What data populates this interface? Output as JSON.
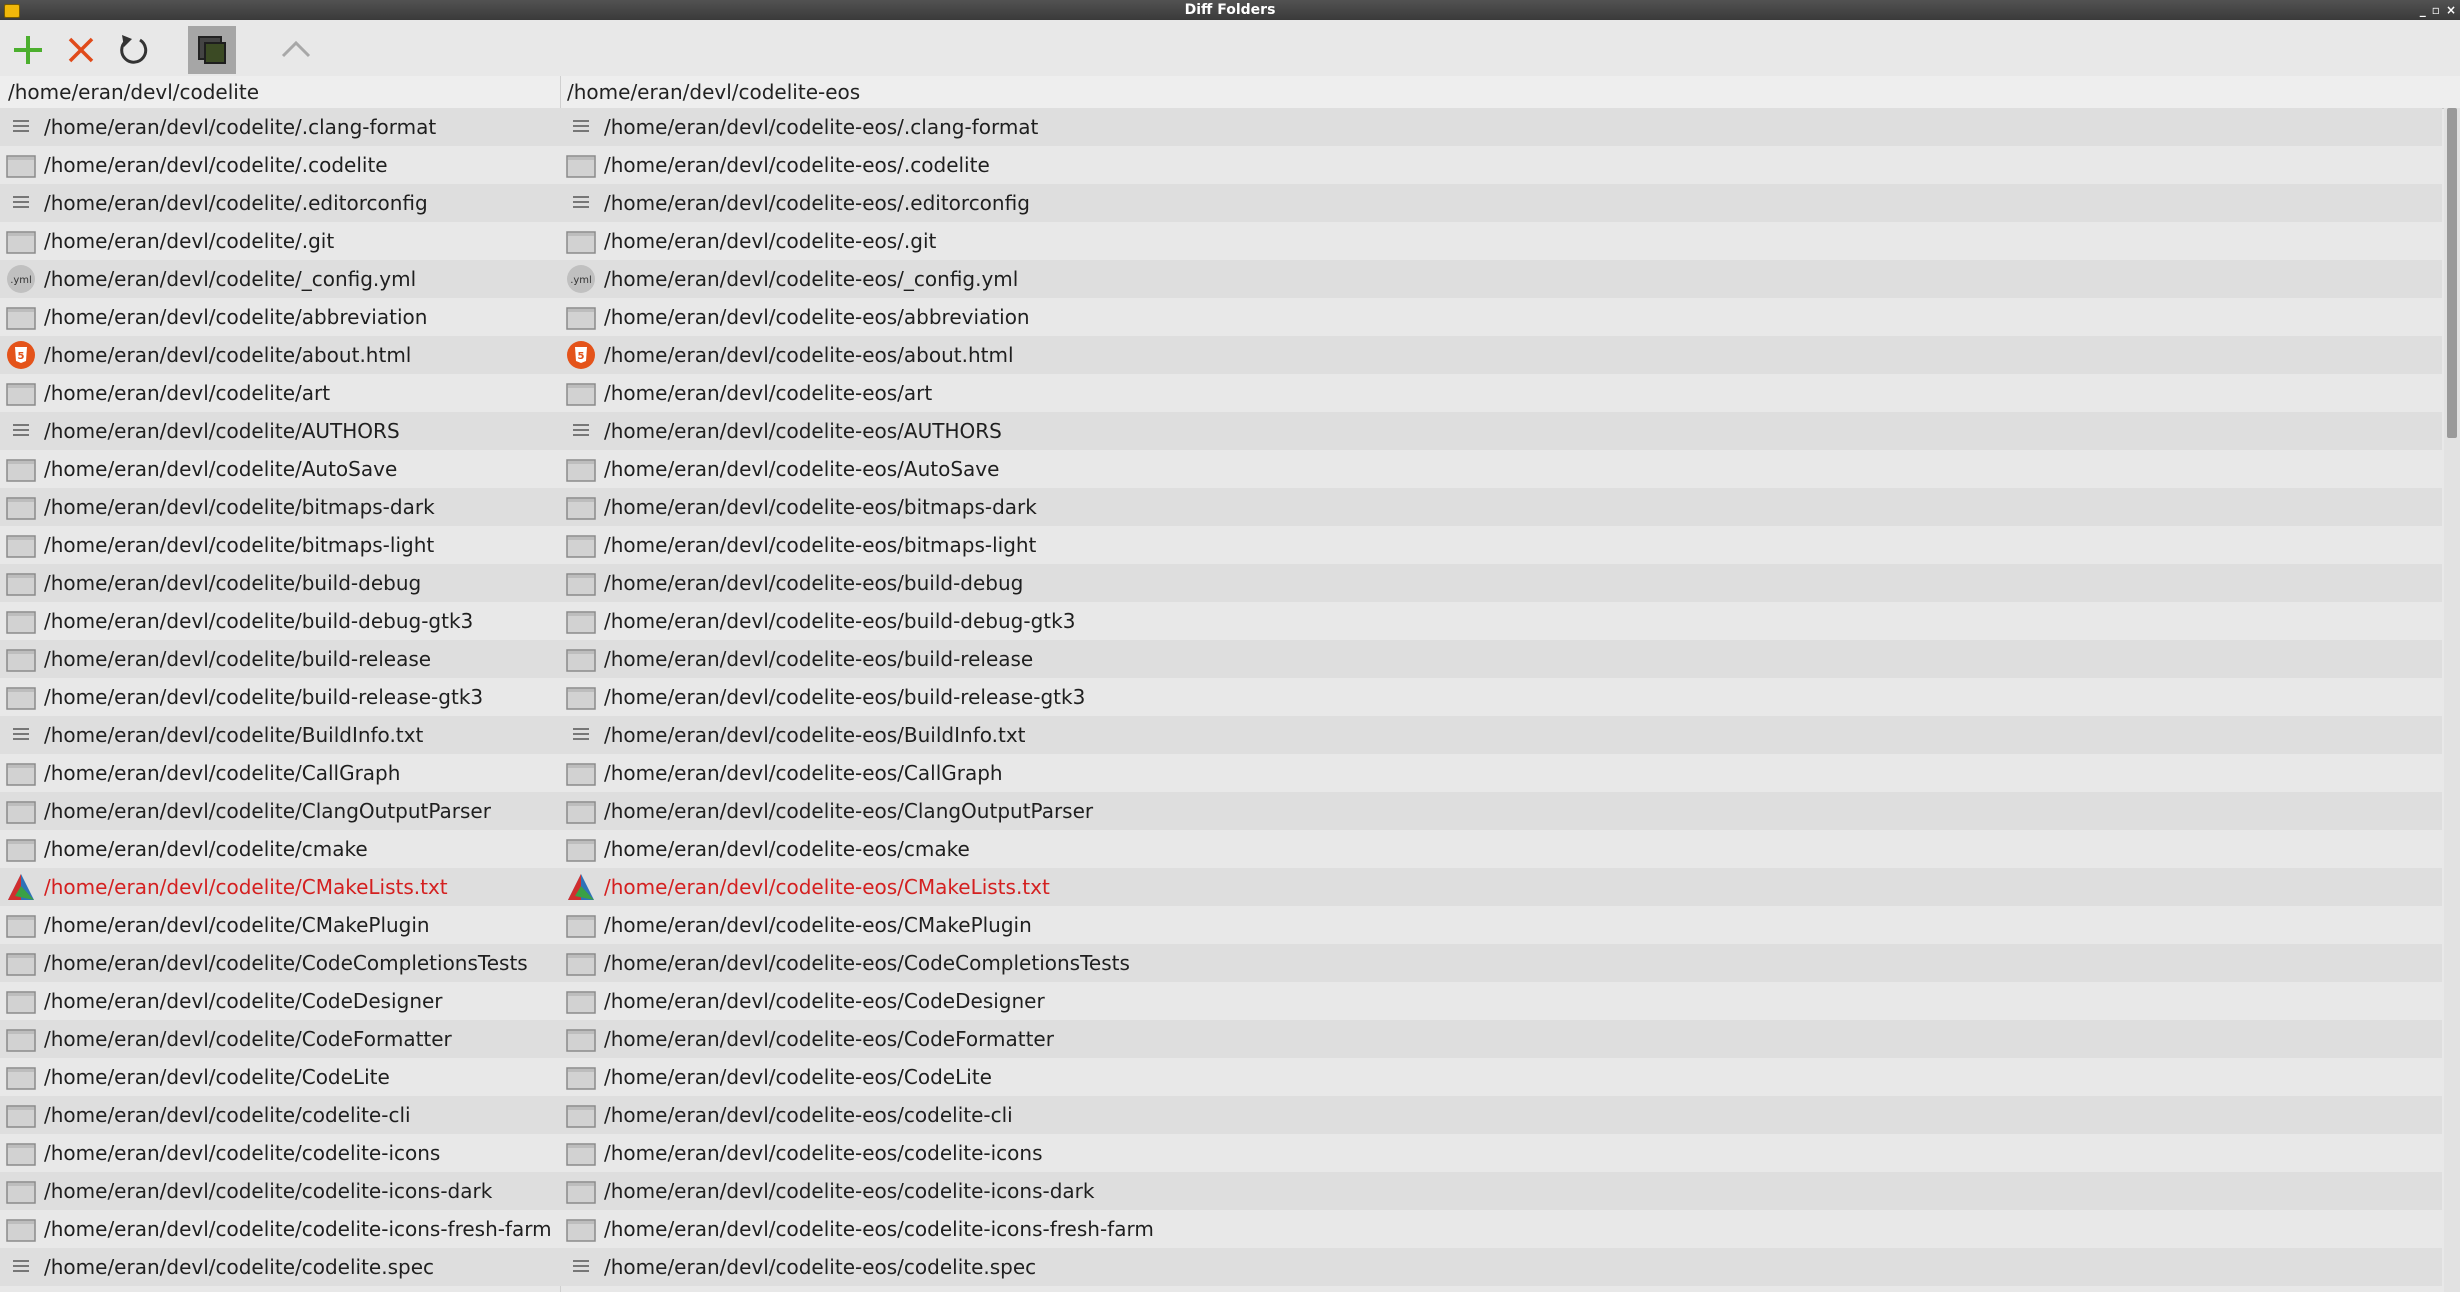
{
  "window": {
    "title": "Diff Folders",
    "controls": [
      "_",
      "▫",
      "×"
    ]
  },
  "toolbar": {
    "buttons": [
      {
        "name": "new-comparison-button",
        "icon": "plus-icon",
        "color": "#4caf2e"
      },
      {
        "name": "clear-button",
        "icon": "close-icon",
        "color": "#e04a1a"
      },
      {
        "name": "refresh-button",
        "icon": "refresh-icon",
        "color": "#333333"
      },
      {
        "name": "show-similar-button",
        "icon": "show-similar-icon",
        "active": true
      },
      {
        "name": "up-folder-button",
        "icon": "chevron-up-icon",
        "disabled": true
      }
    ]
  },
  "headers": {
    "left": "/home/eran/devl/codelite",
    "right": "/home/eran/devl/codelite-eos"
  },
  "colors": {
    "modified": "#d42020",
    "html": "#e4531a"
  },
  "rows": [
    {
      "name": ".clang-format",
      "icon": "text-file-icon",
      "modified": false,
      "left": "/home/eran/devl/codelite/.clang-format",
      "right": "/home/eran/devl/codelite-eos/.clang-format"
    },
    {
      "name": ".codelite",
      "icon": "folder-icon",
      "modified": false,
      "left": "/home/eran/devl/codelite/.codelite",
      "right": "/home/eran/devl/codelite-eos/.codelite"
    },
    {
      "name": ".editorconfig",
      "icon": "text-file-icon",
      "modified": false,
      "left": "/home/eran/devl/codelite/.editorconfig",
      "right": "/home/eran/devl/codelite-eos/.editorconfig"
    },
    {
      "name": ".git",
      "icon": "folder-icon",
      "modified": false,
      "left": "/home/eran/devl/codelite/.git",
      "right": "/home/eran/devl/codelite-eos/.git"
    },
    {
      "name": "_config.yml",
      "icon": "yml-icon",
      "icon_text": ".yml",
      "modified": false,
      "left": "/home/eran/devl/codelite/_config.yml",
      "right": "/home/eran/devl/codelite-eos/_config.yml"
    },
    {
      "name": "abbreviation",
      "icon": "folder-icon",
      "modified": false,
      "left": "/home/eran/devl/codelite/abbreviation",
      "right": "/home/eran/devl/codelite-eos/abbreviation"
    },
    {
      "name": "about.html",
      "icon": "html-icon",
      "icon_text": "5",
      "modified": false,
      "left": "/home/eran/devl/codelite/about.html",
      "right": "/home/eran/devl/codelite-eos/about.html"
    },
    {
      "name": "art",
      "icon": "folder-icon",
      "modified": false,
      "left": "/home/eran/devl/codelite/art",
      "right": "/home/eran/devl/codelite-eos/art"
    },
    {
      "name": "AUTHORS",
      "icon": "text-file-icon",
      "modified": false,
      "left": "/home/eran/devl/codelite/AUTHORS",
      "right": "/home/eran/devl/codelite-eos/AUTHORS"
    },
    {
      "name": "AutoSave",
      "icon": "folder-icon",
      "modified": false,
      "left": "/home/eran/devl/codelite/AutoSave",
      "right": "/home/eran/devl/codelite-eos/AutoSave"
    },
    {
      "name": "bitmaps-dark",
      "icon": "folder-icon",
      "modified": false,
      "left": "/home/eran/devl/codelite/bitmaps-dark",
      "right": "/home/eran/devl/codelite-eos/bitmaps-dark"
    },
    {
      "name": "bitmaps-light",
      "icon": "folder-icon",
      "modified": false,
      "left": "/home/eran/devl/codelite/bitmaps-light",
      "right": "/home/eran/devl/codelite-eos/bitmaps-light"
    },
    {
      "name": "build-debug",
      "icon": "folder-icon",
      "modified": false,
      "left": "/home/eran/devl/codelite/build-debug",
      "right": "/home/eran/devl/codelite-eos/build-debug"
    },
    {
      "name": "build-debug-gtk3",
      "icon": "folder-icon",
      "modified": false,
      "left": "/home/eran/devl/codelite/build-debug-gtk3",
      "right": "/home/eran/devl/codelite-eos/build-debug-gtk3"
    },
    {
      "name": "build-release",
      "icon": "folder-icon",
      "modified": false,
      "left": "/home/eran/devl/codelite/build-release",
      "right": "/home/eran/devl/codelite-eos/build-release"
    },
    {
      "name": "build-release-gtk3",
      "icon": "folder-icon",
      "modified": false,
      "left": "/home/eran/devl/codelite/build-release-gtk3",
      "right": "/home/eran/devl/codelite-eos/build-release-gtk3"
    },
    {
      "name": "BuildInfo.txt",
      "icon": "text-file-icon",
      "modified": false,
      "left": "/home/eran/devl/codelite/BuildInfo.txt",
      "right": "/home/eran/devl/codelite-eos/BuildInfo.txt"
    },
    {
      "name": "CallGraph",
      "icon": "folder-icon",
      "modified": false,
      "left": "/home/eran/devl/codelite/CallGraph",
      "right": "/home/eran/devl/codelite-eos/CallGraph"
    },
    {
      "name": "ClangOutputParser",
      "icon": "folder-icon",
      "modified": false,
      "left": "/home/eran/devl/codelite/ClangOutputParser",
      "right": "/home/eran/devl/codelite-eos/ClangOutputParser"
    },
    {
      "name": "cmake",
      "icon": "folder-icon",
      "modified": false,
      "left": "/home/eran/devl/codelite/cmake",
      "right": "/home/eran/devl/codelite-eos/cmake"
    },
    {
      "name": "CMakeLists.txt",
      "icon": "cmake-icon",
      "modified": true,
      "left": "/home/eran/devl/codelite/CMakeLists.txt",
      "right": "/home/eran/devl/codelite-eos/CMakeLists.txt"
    },
    {
      "name": "CMakePlugin",
      "icon": "folder-icon",
      "modified": false,
      "left": "/home/eran/devl/codelite/CMakePlugin",
      "right": "/home/eran/devl/codelite-eos/CMakePlugin"
    },
    {
      "name": "CodeCompletionsTests",
      "icon": "folder-icon",
      "modified": false,
      "left": "/home/eran/devl/codelite/CodeCompletionsTests",
      "right": "/home/eran/devl/codelite-eos/CodeCompletionsTests"
    },
    {
      "name": "CodeDesigner",
      "icon": "folder-icon",
      "modified": false,
      "left": "/home/eran/devl/codelite/CodeDesigner",
      "right": "/home/eran/devl/codelite-eos/CodeDesigner"
    },
    {
      "name": "CodeFormatter",
      "icon": "folder-icon",
      "modified": false,
      "left": "/home/eran/devl/codelite/CodeFormatter",
      "right": "/home/eran/devl/codelite-eos/CodeFormatter"
    },
    {
      "name": "CodeLite",
      "icon": "folder-icon",
      "modified": false,
      "left": "/home/eran/devl/codelite/CodeLite",
      "right": "/home/eran/devl/codelite-eos/CodeLite"
    },
    {
      "name": "codelite-cli",
      "icon": "folder-icon",
      "modified": false,
      "left": "/home/eran/devl/codelite/codelite-cli",
      "right": "/home/eran/devl/codelite-eos/codelite-cli"
    },
    {
      "name": "codelite-icons",
      "icon": "folder-icon",
      "modified": false,
      "left": "/home/eran/devl/codelite/codelite-icons",
      "right": "/home/eran/devl/codelite-eos/codelite-icons"
    },
    {
      "name": "codelite-icons-dark",
      "icon": "folder-icon",
      "modified": false,
      "left": "/home/eran/devl/codelite/codelite-icons-dark",
      "right": "/home/eran/devl/codelite-eos/codelite-icons-dark"
    },
    {
      "name": "codelite-icons-fresh-farm",
      "icon": "folder-icon",
      "modified": false,
      "left": "/home/eran/devl/codelite/codelite-icons-fresh-farm",
      "right": "/home/eran/devl/codelite-eos/codelite-icons-fresh-farm"
    },
    {
      "name": "codelite.spec",
      "icon": "text-file-icon",
      "modified": false,
      "left": "/home/eran/devl/codelite/codelite.spec",
      "right": "/home/eran/devl/codelite-eos/codelite.spec"
    }
  ]
}
